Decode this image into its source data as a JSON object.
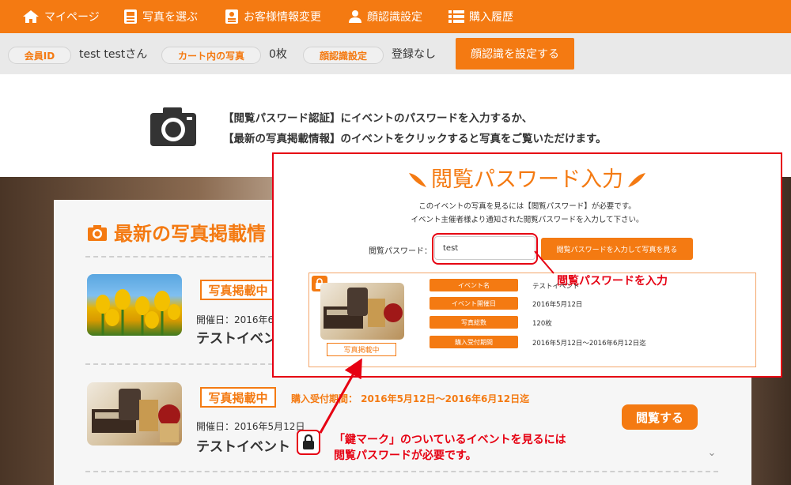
{
  "nav": {
    "items": [
      {
        "label": "マイページ",
        "icon": "home-icon"
      },
      {
        "label": "写真を選ぶ",
        "icon": "photo-icon"
      },
      {
        "label": "お客様情報変更",
        "icon": "profile-card-icon"
      },
      {
        "label": "顔認識設定",
        "icon": "person-icon"
      },
      {
        "label": "購入履歴",
        "icon": "list-icon"
      }
    ]
  },
  "status": {
    "member_id_label": "会員ID",
    "member_id_value": "test testさん",
    "cart_label": "カート内の写真",
    "cart_value": "0枚",
    "face_label": "顔認識設定",
    "face_value": "登録なし",
    "face_button": "顔認識を設定する"
  },
  "notice": {
    "line1": "【閲覧パスワード認証】にイベントのパスワードを入力するか、",
    "line2": "【最新の写真掲載情報】のイベントをクリックすると写真をご覧いただけます。"
  },
  "list": {
    "title": "最新の写真掲載情",
    "events": [
      {
        "badge": "写真掲載中",
        "date": "開催日：2016年6",
        "name": "テストイベン"
      },
      {
        "badge": "写真掲載中",
        "period": "購入受付期間： 2016年5月12日～2016年6月12日迄",
        "date": "開催日：2016年5月12日",
        "name": "テストイベント",
        "view_button": "閲覧する"
      }
    ]
  },
  "callout": {
    "line1": "「鍵マーク」のついているイベントを見るには",
    "line2": "閲覧パスワードが必要です。"
  },
  "popup": {
    "title": "閲覧パスワード入力",
    "desc1": "このイベントの写真を見るには【閲覧パスワード】が必要です。",
    "desc2": "イベント主催者様より通知された閲覧パスワードを入力して下さい。",
    "password_label": "閲覧パスワード：",
    "password_value": "test",
    "submit_button": "閲覧パスワードを入力して写真を見る",
    "annotation": "閲覧パスワードを入力",
    "card": {
      "badge": "写真掲載中",
      "rows": [
        {
          "label": "イベント名",
          "value": "テストイベント"
        },
        {
          "label": "イベント開催日",
          "value": "2016年5月12日"
        },
        {
          "label": "写真総数",
          "value": "120枚"
        },
        {
          "label": "購入受付期間",
          "value": "2016年5月12日～2016年6月12日迄"
        }
      ]
    }
  },
  "colors": {
    "accent": "#f47a12",
    "highlight": "#e60012"
  }
}
